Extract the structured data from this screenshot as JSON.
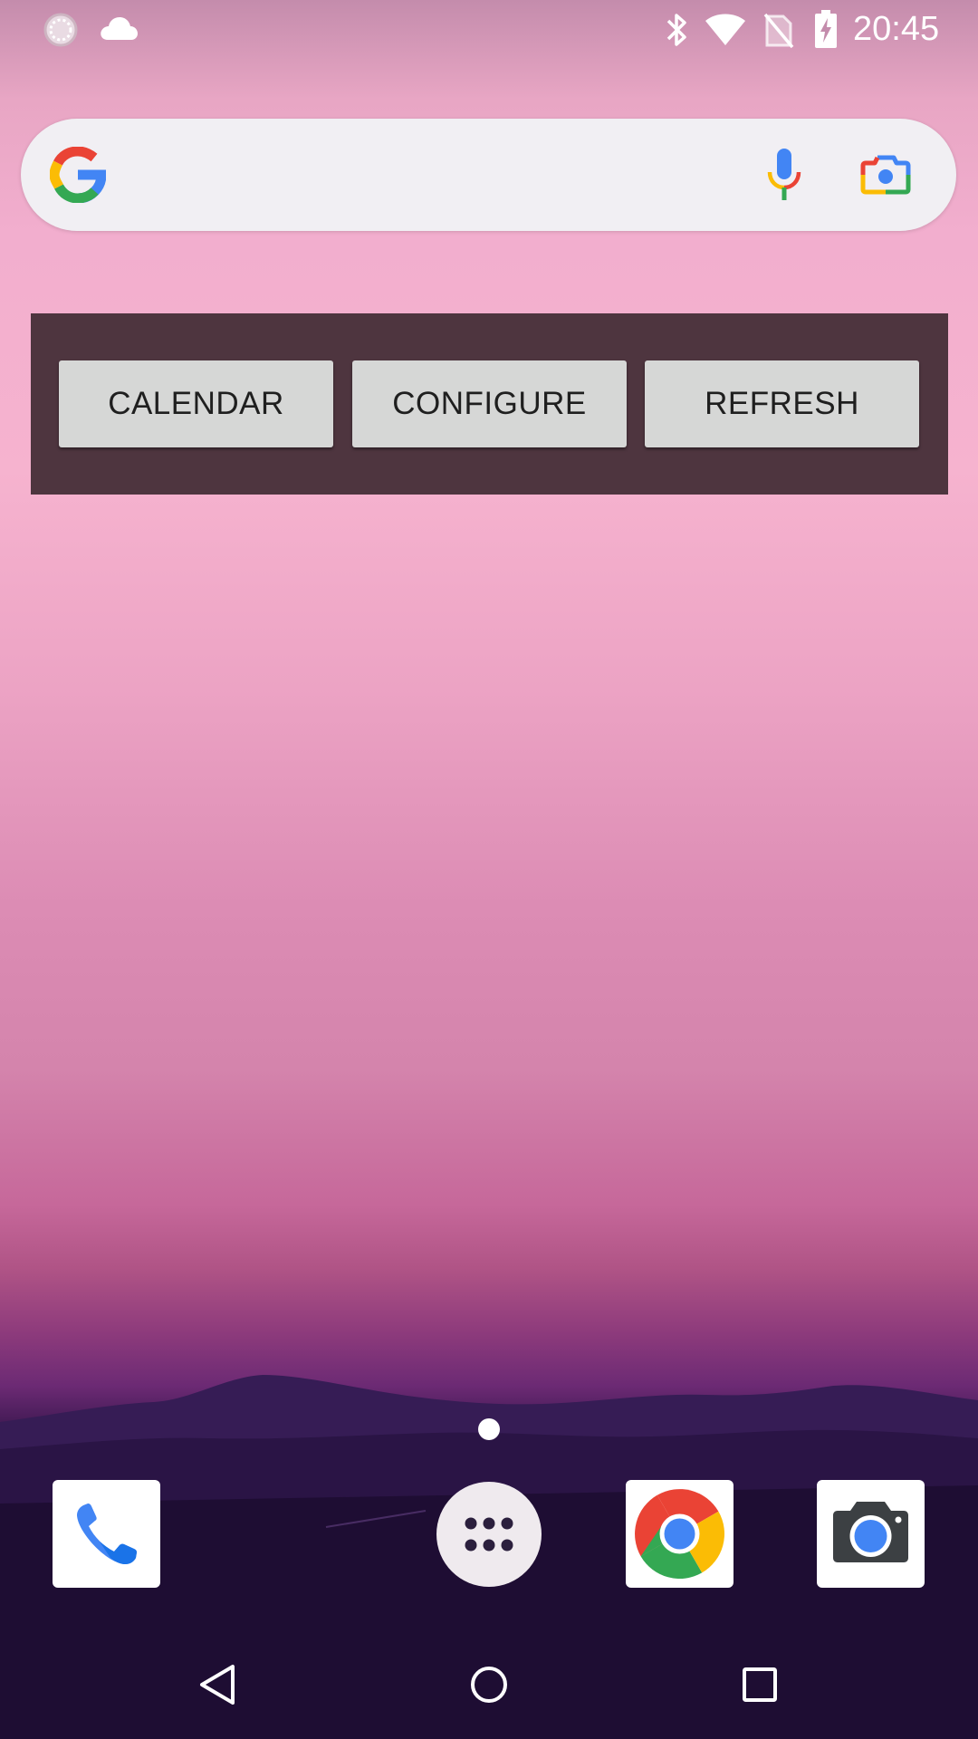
{
  "status_bar": {
    "time": "20:45",
    "left_icons": [
      "loading-circle-icon",
      "cloud-icon"
    ],
    "right_icons": [
      "bluetooth-icon",
      "wifi-icon",
      "no-sim-icon",
      "battery-charging-icon"
    ]
  },
  "search_bar": {
    "logo": "google-g-icon",
    "voice": "mic-icon",
    "lens": "lens-camera-icon"
  },
  "widget": {
    "buttons": [
      {
        "label": "CALENDAR"
      },
      {
        "label": "CONFIGURE"
      },
      {
        "label": "REFRESH"
      }
    ]
  },
  "home": {
    "page_count": 1,
    "current_page": 1
  },
  "dock": {
    "items": [
      {
        "icon": "phone-icon"
      },
      {
        "icon": "app-drawer-icon"
      },
      {
        "icon": "chrome-icon"
      },
      {
        "icon": "camera-icon"
      }
    ]
  },
  "nav_bar": {
    "buttons": [
      "back-icon",
      "home-icon",
      "recents-icon"
    ]
  },
  "colors": {
    "google_blue": "#4285F4",
    "google_red": "#EA4335",
    "google_yellow": "#FBBC05",
    "google_green": "#34A853",
    "widget_background": "#4E353F",
    "widget_button": "#D6D7D6"
  }
}
